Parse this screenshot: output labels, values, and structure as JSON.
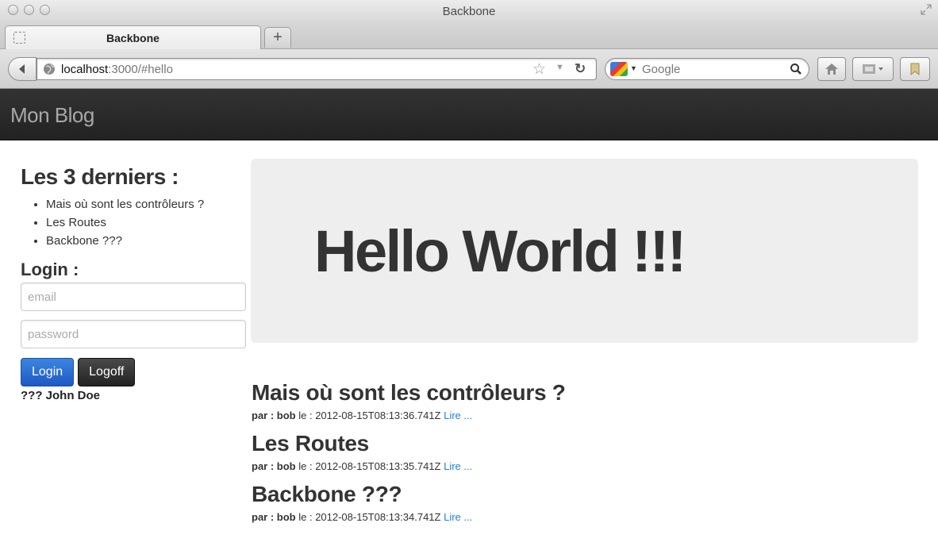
{
  "window": {
    "title": "Backbone",
    "tab_label": "Backbone",
    "new_tab_label": "+"
  },
  "navbar": {
    "url_host": "localhost",
    "url_rest": ":3000/#hello",
    "search_engine": "Google"
  },
  "site": {
    "brand": "Mon Blog"
  },
  "sidebar": {
    "recent_title": "Les 3 derniers :",
    "recent_items": [
      "Mais où sont les contrôleurs ?",
      "Les Routes",
      "Backbone ???"
    ],
    "login_title": "Login :",
    "email_placeholder": "email",
    "password_placeholder": "password",
    "login_button": "Login",
    "logoff_button": "Logoff",
    "user_status": "??? John Doe"
  },
  "hero": {
    "text": "Hello World !!!"
  },
  "posts": [
    {
      "title": "Mais où sont les contrôleurs ?",
      "by_label": "par : bob",
      "date_label": "le : 2012-08-15T08:13:36.741Z",
      "link": "Lire ..."
    },
    {
      "title": "Les Routes",
      "by_label": "par : bob",
      "date_label": "le : 2012-08-15T08:13:35.741Z",
      "link": "Lire ..."
    },
    {
      "title": "Backbone ???",
      "by_label": "par : bob",
      "date_label": "le : 2012-08-15T08:13:34.741Z",
      "link": "Lire ..."
    }
  ],
  "colors": {
    "header_bg": "#222222",
    "hero_bg": "#eeeeee",
    "login_button": "#2a6fd6",
    "link": "#1f7fdf"
  }
}
